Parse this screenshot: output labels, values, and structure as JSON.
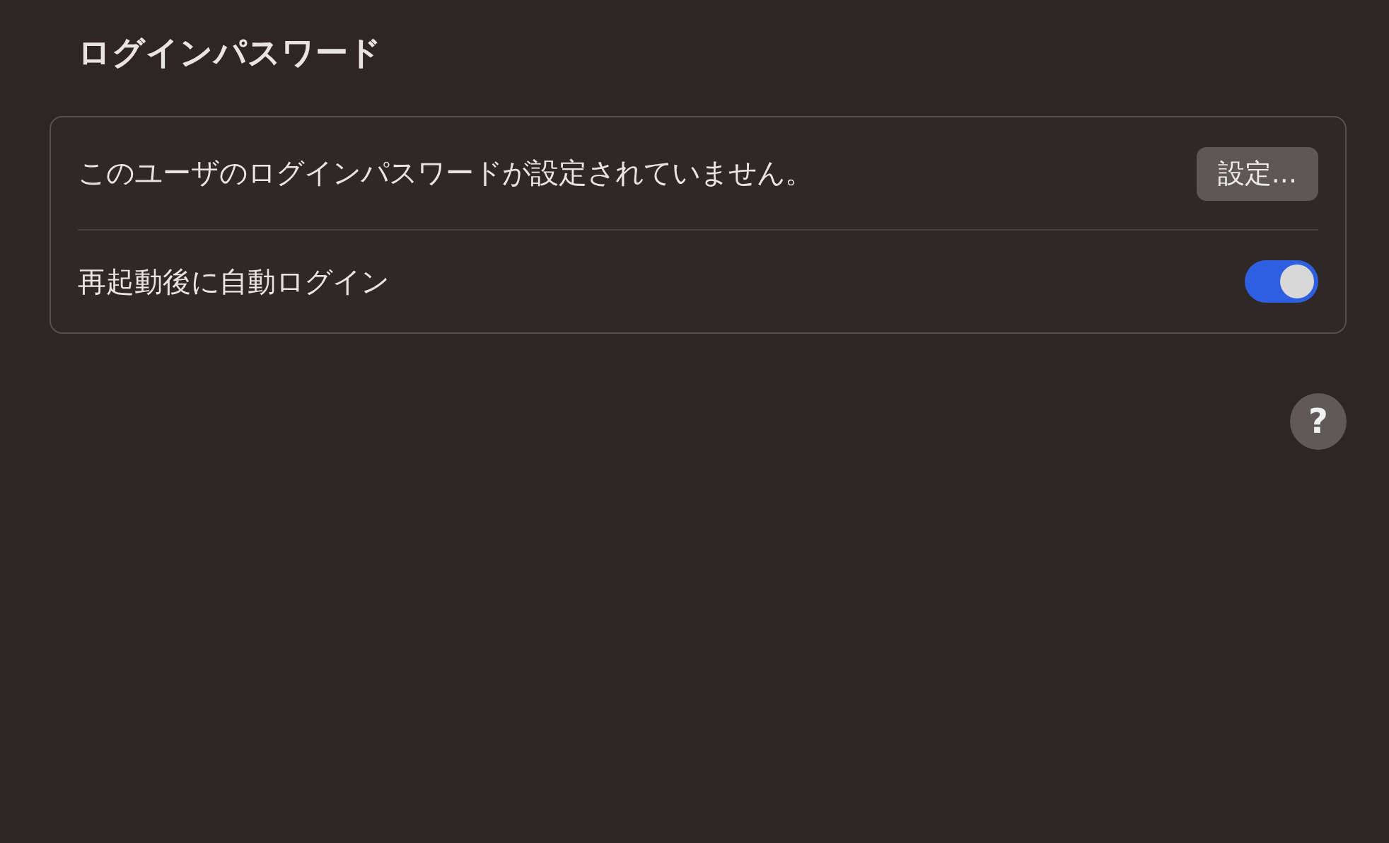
{
  "section": {
    "title": "ログインパスワード"
  },
  "rows": [
    {
      "kind": "button",
      "label": "このユーザのログインパスワードが設定されていません。",
      "button": "設定..."
    },
    {
      "kind": "toggle",
      "label": "再起動後に自動ログイン",
      "on": true
    }
  ],
  "help": {
    "label": "?"
  }
}
